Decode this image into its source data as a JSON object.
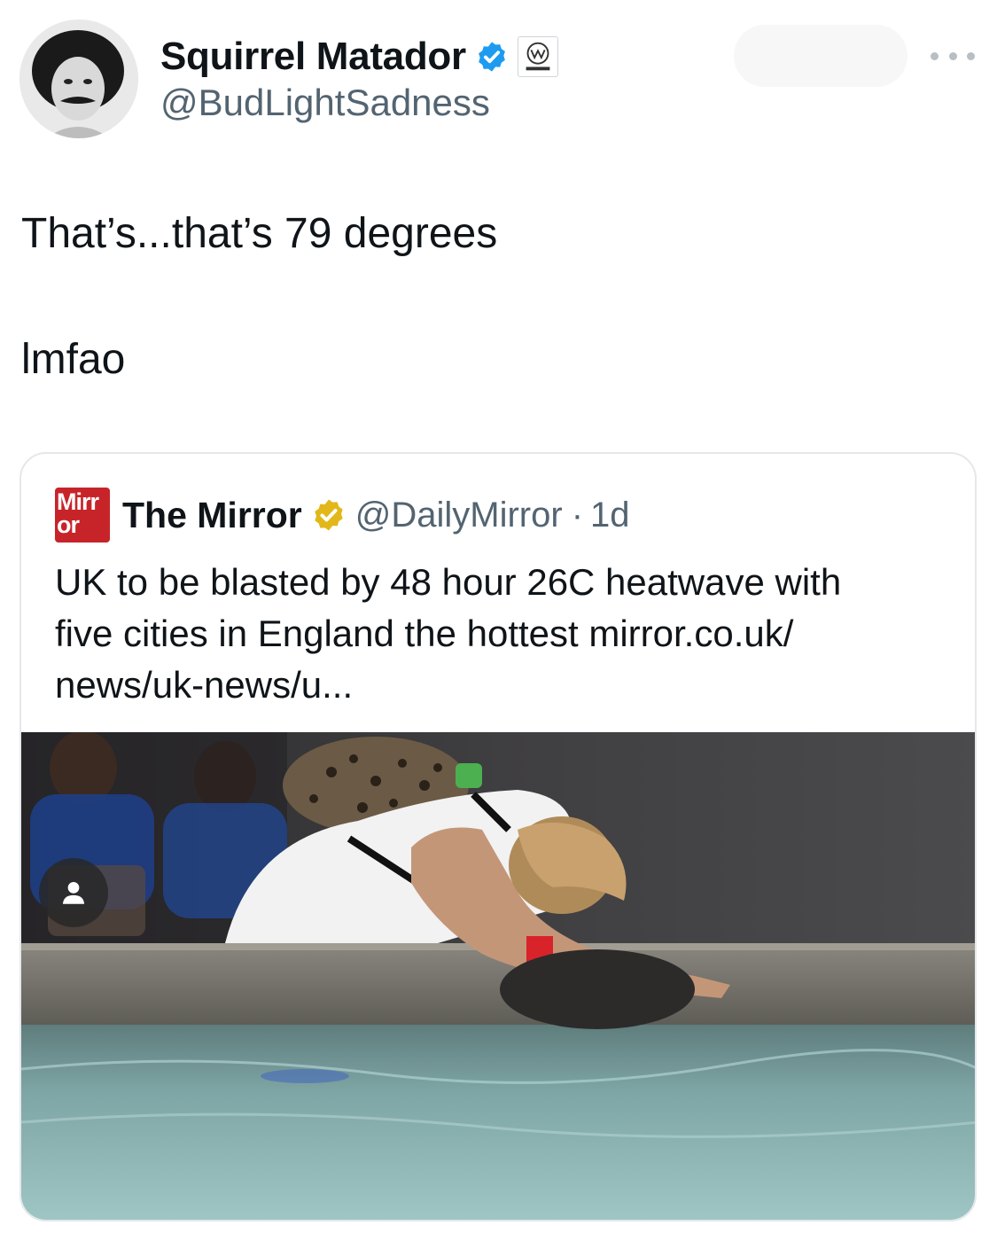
{
  "author": {
    "display_name": "Squirrel Matador",
    "handle": "@BudLightSadness",
    "verified": true,
    "affiliate_badge_text": "WARGATE"
  },
  "tweet": {
    "line1": "That’s...that’s 79 degrees",
    "line2": "lmfao"
  },
  "quote": {
    "logo_line1": "Mirr",
    "logo_line2": "or",
    "name": "The Mirror",
    "handle": "@DailyMirror",
    "separator": "·",
    "time": "1d",
    "text_lines": [
      "UK to be blasted by 48 hour 26C heatwave with",
      "five cities in England the hottest mirror.co.uk/",
      "news/uk-news/u..."
    ]
  },
  "colors": {
    "verified_blue": "#1d9bf0",
    "verified_gold": "#e2b719",
    "mirror_red": "#c7242a",
    "secondary_text": "#536471"
  }
}
